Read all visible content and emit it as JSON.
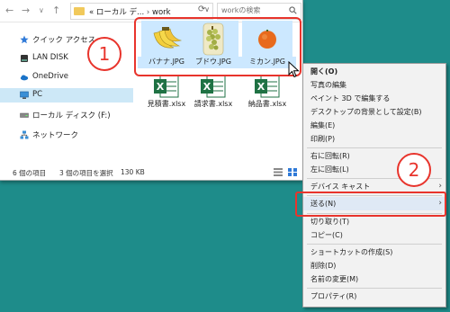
{
  "address": {
    "root_label": "«",
    "segment1": "ローカル デ...",
    "separator": "›",
    "segment2": "work",
    "search_placeholder": "workの検索"
  },
  "sidebar": {
    "items": [
      {
        "label": "クイック アクセス"
      },
      {
        "label": "LAN DISK"
      },
      {
        "label": "OneDrive"
      },
      {
        "label": "PC"
      },
      {
        "label": "ローカル ディスク (F:)"
      },
      {
        "label": "ネットワーク"
      }
    ]
  },
  "files": [
    {
      "name": "バナナ.JPG"
    },
    {
      "name": "ブドウ.JPG"
    },
    {
      "name": "ミカン.JPG"
    },
    {
      "name": "見積書.xlsx"
    },
    {
      "name": "請求書.xlsx"
    },
    {
      "name": "納品書.xlsx"
    }
  ],
  "status": {
    "item_count": "6 個の項目",
    "selection": "3 個の項目を選択",
    "size": "130 KB"
  },
  "callouts": {
    "one": "1",
    "two": "2"
  },
  "context_menu": {
    "items": [
      "開く(O)",
      "写真の編集",
      "ペイント 3D で編集する",
      "デスクトップの背景として設定(B)",
      "編集(E)",
      "印刷(P)",
      "右に回転(R)",
      "左に回転(L)",
      "デバイス キャスト",
      "送る(N)",
      "切り取り(T)",
      "コピー(C)",
      "ショートカットの作成(S)",
      "削除(D)",
      "名前の変更(M)",
      "プロパティ(R)"
    ]
  },
  "colors": {
    "desktop": "#1e8c8a",
    "highlight": "#e8342c",
    "selection": "#cce8ff"
  }
}
